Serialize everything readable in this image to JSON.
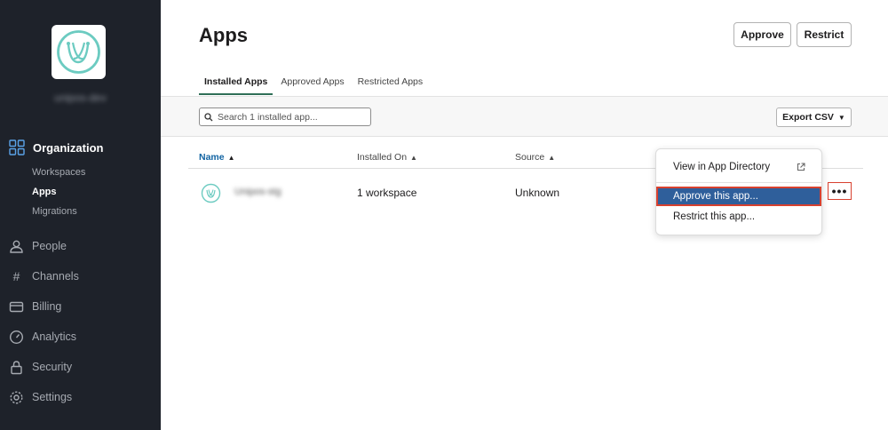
{
  "sidebar": {
    "org_name": "unipos-dev",
    "section": "Organization",
    "sub_items": [
      "Workspaces",
      "Apps",
      "Migrations"
    ],
    "items": [
      {
        "label": "People",
        "icon": "person-icon"
      },
      {
        "label": "Channels",
        "icon": "hash-icon"
      },
      {
        "label": "Billing",
        "icon": "card-icon"
      },
      {
        "label": "Analytics",
        "icon": "gauge-icon"
      },
      {
        "label": "Security",
        "icon": "lock-icon"
      },
      {
        "label": "Settings",
        "icon": "gear-icon"
      }
    ]
  },
  "header": {
    "title": "Apps",
    "approve_label": "Approve",
    "restrict_label": "Restrict"
  },
  "tabs": [
    "Installed Apps",
    "Approved Apps",
    "Restricted Apps"
  ],
  "toolbar": {
    "search_placeholder": "Search 1 installed app...",
    "export_label": "Export CSV"
  },
  "table": {
    "columns": [
      "Name",
      "Installed On",
      "Source"
    ],
    "rows": [
      {
        "name": "Unipos-stg",
        "installed_on": "1 workspace",
        "source": "Unknown"
      }
    ],
    "more_label": "•••"
  },
  "menu": {
    "items": [
      "View in App Directory",
      "Approve this app...",
      "Restrict this app..."
    ]
  },
  "colors": {
    "sidebar_bg": "#1e222a",
    "accent_green": "#2f6f57",
    "link_blue": "#1264a3",
    "highlight_blue": "#2f5f9b",
    "annotation_red": "#d8412f",
    "logo_teal": "#6ccbc1"
  }
}
